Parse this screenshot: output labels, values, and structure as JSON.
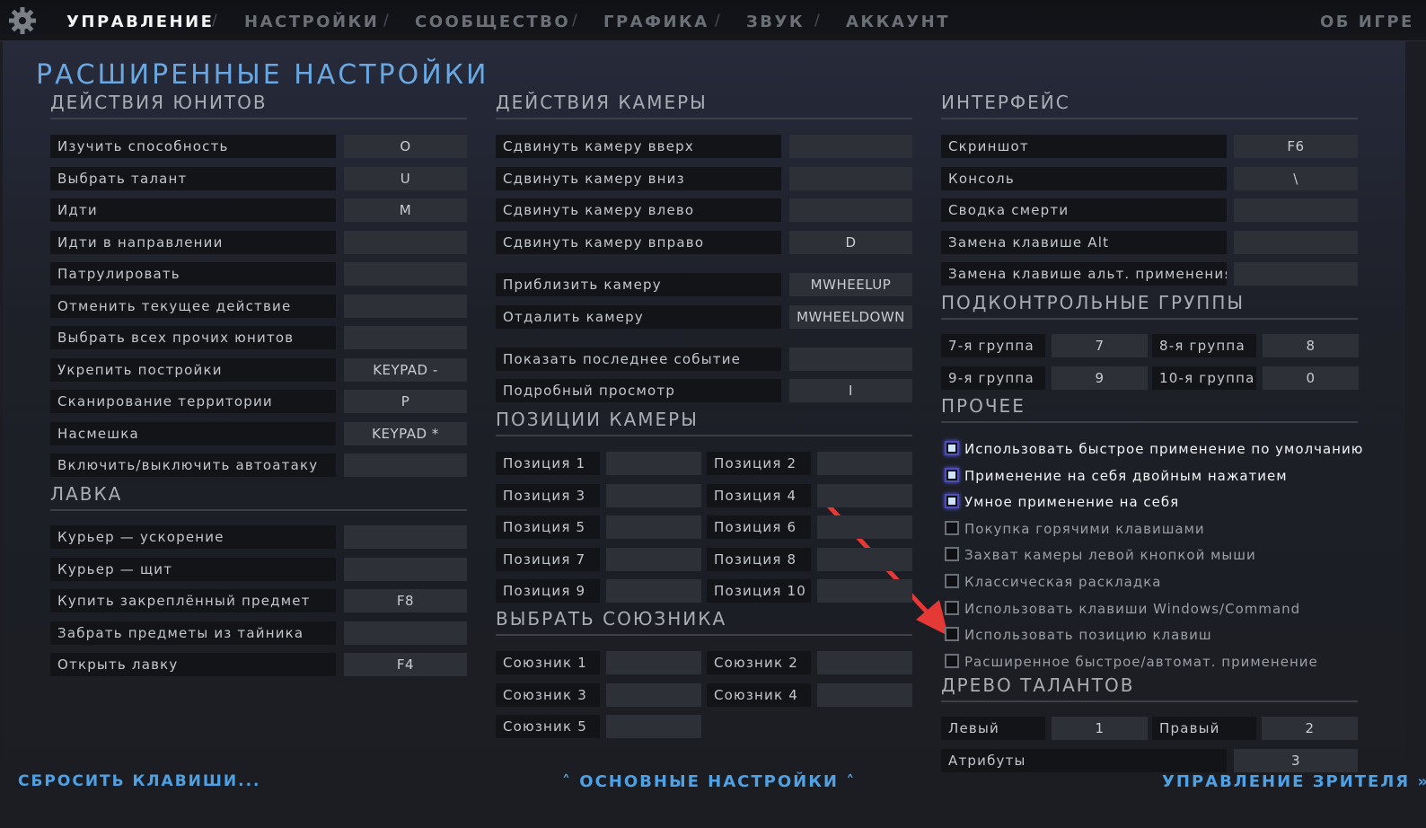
{
  "nav": {
    "tabs": [
      "УПРАВЛЕНИЕ",
      "НАСТРОЙКИ",
      "СООБЩЕСТВО",
      "ГРАФИКА",
      "ЗВУК",
      "АККАУНТ"
    ],
    "separator": "/",
    "about": "ОБ ИГРЕ"
  },
  "title": "РАСШИРЕННЫЕ НАСТРОЙКИ",
  "unit_actions": {
    "heading": "ДЕЙСТВИЯ ЮНИТОВ",
    "rows": [
      {
        "label": "Изучить способность",
        "key": "O"
      },
      {
        "label": "Выбрать талант",
        "key": "U"
      },
      {
        "label": "Идти",
        "key": "M"
      },
      {
        "label": "Идти в направлении",
        "key": ""
      },
      {
        "label": "Патрулировать",
        "key": ""
      },
      {
        "label": "Отменить текущее действие",
        "key": ""
      },
      {
        "label": "Выбрать всех прочих юнитов",
        "key": ""
      },
      {
        "label": "Укрепить постройки",
        "key": "KEYPAD -"
      },
      {
        "label": "Сканирование территории",
        "key": "P"
      },
      {
        "label": "Насмешка",
        "key": "KEYPAD *"
      },
      {
        "label": "Включить/выключить автоатаку",
        "key": ""
      }
    ]
  },
  "shop": {
    "heading": "ЛАВКА",
    "rows": [
      {
        "label": "Курьер — ускорение",
        "key": ""
      },
      {
        "label": "Курьер — щит",
        "key": ""
      },
      {
        "label": "Купить закреплённый предмет",
        "key": "F8"
      },
      {
        "label": "Забрать предметы из тайника",
        "key": ""
      },
      {
        "label": "Открыть лавку",
        "key": "F4"
      }
    ]
  },
  "camera_actions": {
    "heading": "ДЕЙСТВИЯ КАМЕРЫ",
    "rows": [
      {
        "label": "Сдвинуть камеру вверх",
        "key": ""
      },
      {
        "label": "Сдвинуть камеру вниз",
        "key": ""
      },
      {
        "label": "Сдвинуть камеру влево",
        "key": ""
      },
      {
        "label": "Сдвинуть камеру вправо",
        "key": "D"
      },
      {
        "label": "Приблизить камеру",
        "key": "MWHEELUP"
      },
      {
        "label": "Отдалить камеру",
        "key": "MWHEELDOWN"
      },
      {
        "label": "Показать последнее событие",
        "key": ""
      },
      {
        "label": "Подробный просмотр",
        "key": "I"
      }
    ]
  },
  "camera_positions": {
    "heading": "ПОЗИЦИИ КАМЕРЫ",
    "items": [
      {
        "label": "Позиция 1",
        "key": ""
      },
      {
        "label": "Позиция 2",
        "key": ""
      },
      {
        "label": "Позиция 3",
        "key": ""
      },
      {
        "label": "Позиция 4",
        "key": ""
      },
      {
        "label": "Позиция 5",
        "key": ""
      },
      {
        "label": "Позиция 6",
        "key": ""
      },
      {
        "label": "Позиция 7",
        "key": ""
      },
      {
        "label": "Позиция 8",
        "key": ""
      },
      {
        "label": "Позиция 9",
        "key": ""
      },
      {
        "label": "Позиция 10",
        "key": ""
      }
    ]
  },
  "select_ally": {
    "heading": "ВЫБРАТЬ СОЮЗНИКА",
    "items": [
      {
        "label": "Союзник 1",
        "key": ""
      },
      {
        "label": "Союзник 2",
        "key": ""
      },
      {
        "label": "Союзник 3",
        "key": ""
      },
      {
        "label": "Союзник 4",
        "key": ""
      },
      {
        "label": "Союзник 5",
        "key": ""
      }
    ]
  },
  "interface": {
    "heading": "ИНТЕРФЕЙС",
    "rows": [
      {
        "label": "Скриншот",
        "key": "F6"
      },
      {
        "label": "Консоль",
        "key": "\\"
      },
      {
        "label": "Сводка смерти",
        "key": ""
      },
      {
        "label": "Замена клавише Alt",
        "key": ""
      },
      {
        "label": "Замена клавише альт. применения",
        "key": ""
      }
    ]
  },
  "control_groups": {
    "heading": "ПОДКОНТРОЛЬНЫЕ ГРУППЫ",
    "items": [
      {
        "label": "7-я группа",
        "key": "7"
      },
      {
        "label": "8-я группа",
        "key": "8"
      },
      {
        "label": "9-я группа",
        "key": "9"
      },
      {
        "label": "10-я группа",
        "key": "0"
      }
    ]
  },
  "misc": {
    "heading": "ПРОЧЕЕ",
    "options": [
      {
        "label": "Использовать быстрое применение по умолчанию",
        "checked": true
      },
      {
        "label": "Применение на себя двойным нажатием",
        "checked": true
      },
      {
        "label": "Умное применение на себя",
        "checked": true
      },
      {
        "label": "Покупка горячими клавишами",
        "checked": false
      },
      {
        "label": "Захват камеры левой кнопкой мыши",
        "checked": false
      },
      {
        "label": "Классическая раскладка",
        "checked": false
      },
      {
        "label": "Использовать клавиши Windows/Command",
        "checked": false
      },
      {
        "label": "Использовать позицию клавиш",
        "checked": false
      },
      {
        "label": "Расширенное быстрое/автомат. применение",
        "checked": false
      }
    ]
  },
  "talent_tree": {
    "heading": "ДРЕВО ТАЛАНТОВ",
    "left_label": "Левый",
    "left_key": "1",
    "right_label": "Правый",
    "right_key": "2",
    "attr_label": "Атрибуты",
    "attr_key": "3"
  },
  "footer": {
    "reset": "СБРОСИТЬ КЛАВИШИ...",
    "basic": "ОСНОВНЫЕ НАСТРОЙКИ",
    "spectator": "УПРАВЛЕНИЕ ЗРИТЕЛЯ"
  },
  "colors": {
    "accent": "#4ea1e4",
    "title": "#6aa7e0",
    "annotation_arrow": "#e53935"
  }
}
